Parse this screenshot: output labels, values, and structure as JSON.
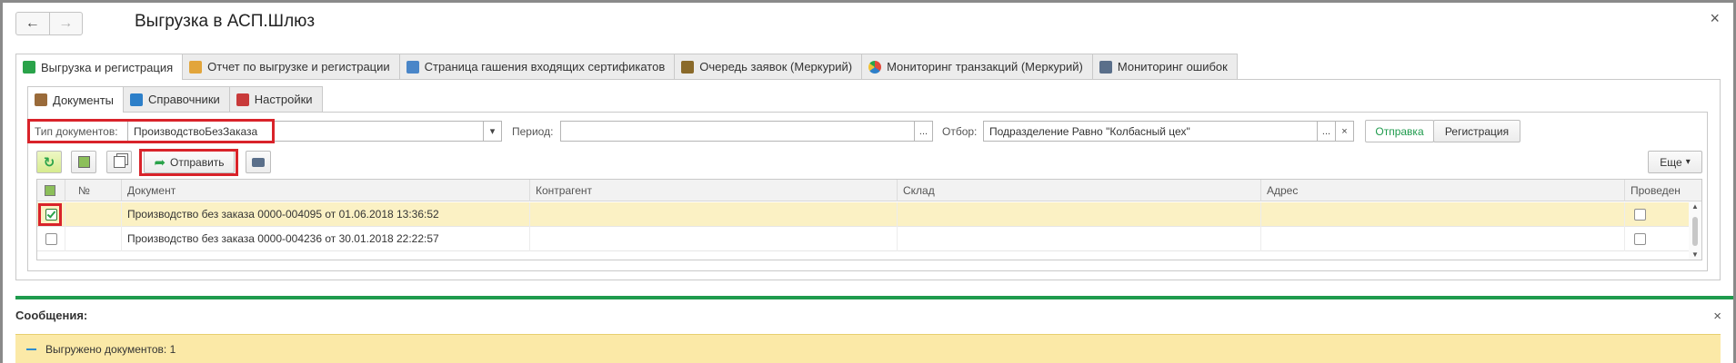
{
  "window": {
    "title": "Выгрузка в АСП.Шлюз",
    "back_glyph": "←",
    "forward_glyph": "→",
    "close_glyph": "×"
  },
  "main_tabs": [
    {
      "label": "Выгрузка и регистрация",
      "icon": "upload-icon",
      "color": "#2aa34a"
    },
    {
      "label": "Отчет по выгрузке и регистрации",
      "icon": "report-icon",
      "color": "#e2a53b"
    },
    {
      "label": "Страница гашения входящих сертификатов",
      "icon": "certificate-icon",
      "color": "#4a86c8"
    },
    {
      "label": "Очередь заявок (Меркурий)",
      "icon": "queue-icon",
      "color": "#8a6a2a"
    },
    {
      "label": "Мониторинг транзакций (Меркурий)",
      "icon": "pie-chart-icon",
      "color": "#e2493a"
    },
    {
      "label": "Мониторинг ошибок",
      "icon": "monitor-icon",
      "color": "#5a6f8a"
    }
  ],
  "sub_tabs": [
    {
      "label": "Документы",
      "icon": "briefcase-icon",
      "color": "#9a6b3a"
    },
    {
      "label": "Справочники",
      "icon": "book-icon",
      "color": "#2d7fc9"
    },
    {
      "label": "Настройки",
      "icon": "settings-icon",
      "color": "#c83a3a"
    }
  ],
  "filters": {
    "doc_type_label": "Тип документов:",
    "doc_type_value": "ПроизводствоБезЗаказа",
    "period_label": "Период:",
    "period_value": "",
    "select_button": "...",
    "filter_label": "Отбор:",
    "filter_value": "Подразделение Равно \"Колбасный цех\"",
    "clear_glyph": "×",
    "dropdown_glyph": "▾",
    "toggle_send": "Отправка",
    "toggle_register": "Регистрация"
  },
  "toolbar": {
    "refresh_glyph": "↻",
    "send_label": "Отправить",
    "more_label": "Еще",
    "more_glyph": "▾"
  },
  "table": {
    "columns": [
      "№",
      "Документ",
      "Контрагент",
      "Склад",
      "Адрес",
      "Проведен"
    ],
    "rows": [
      {
        "checked": true,
        "num": "",
        "document": "Производство без заказа 0000-004095 от 01.06.2018 13:36:52",
        "counterparty": "",
        "warehouse": "",
        "address": "",
        "posted": false
      },
      {
        "checked": false,
        "num": "",
        "document": "Производство без заказа 0000-004236 от 30.01.2018 22:22:57",
        "counterparty": "",
        "warehouse": "",
        "address": "",
        "posted": false
      }
    ]
  },
  "messages": {
    "title": "Сообщения:",
    "close_glyph": "×",
    "text": "Выгружено документов: 1"
  },
  "colors": {
    "accent_green": "#1f9b4d",
    "highlight_red": "#d9232a",
    "selected_row": "#fbf1c4",
    "message_bar": "#fbe9a7"
  }
}
